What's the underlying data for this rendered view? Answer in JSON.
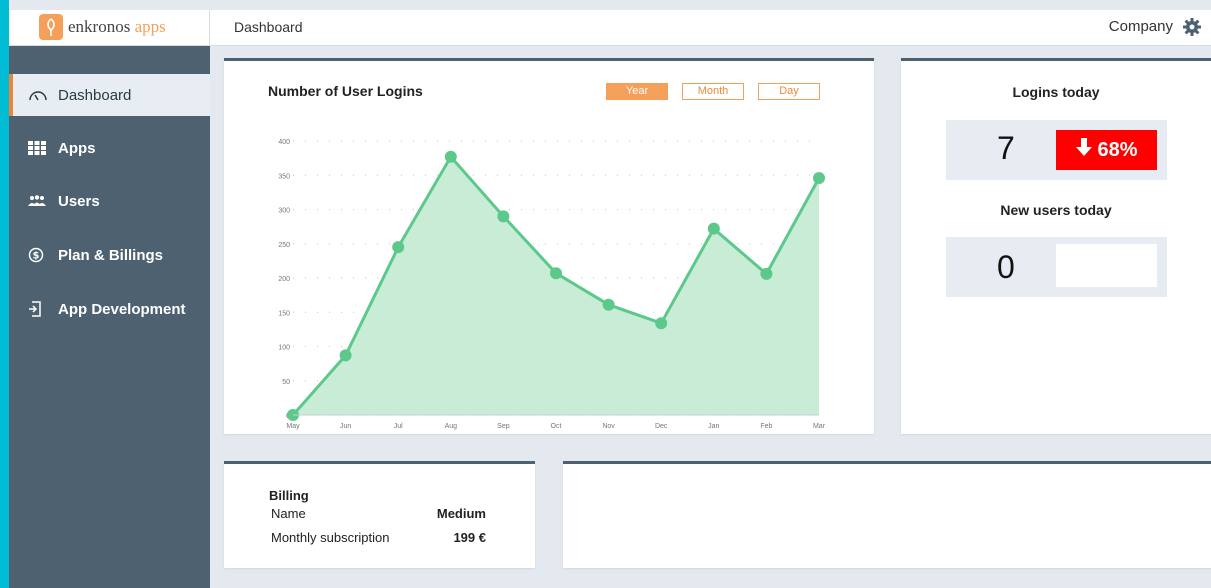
{
  "app": {
    "logo_name": "enkronos",
    "logo_suffix": "apps",
    "page_title": "Dashboard",
    "company_label": "Company"
  },
  "sidebar": {
    "items": [
      {
        "label": "Dashboard",
        "icon": "gauge-icon",
        "active": true
      },
      {
        "label": "Apps",
        "icon": "grid-icon",
        "active": false
      },
      {
        "label": "Users",
        "icon": "users-icon",
        "active": false
      },
      {
        "label": "Plan & Billings",
        "icon": "dollar-circle-icon",
        "active": false
      },
      {
        "label": "App Development",
        "icon": "exit-door-icon",
        "active": false
      }
    ]
  },
  "chart_panel": {
    "title": "Number of User Logins",
    "ranges": [
      {
        "label": "Year",
        "active": true
      },
      {
        "label": "Month",
        "active": false
      },
      {
        "label": "Day",
        "active": false
      }
    ]
  },
  "chart_data": {
    "type": "area",
    "title": "Number of User Logins",
    "categories": [
      "May",
      "Jun",
      "Jul",
      "Aug",
      "Sep",
      "Oct",
      "Nov",
      "Dec",
      "Jan",
      "Feb",
      "Mar"
    ],
    "values": [
      0,
      87,
      245,
      377,
      290,
      207,
      161,
      134,
      272,
      206,
      346
    ],
    "y_ticks": [
      0,
      50,
      100,
      150,
      200,
      250,
      300,
      350,
      400
    ],
    "ylim": [
      0,
      400
    ],
    "grid": "dotted",
    "colors": {
      "line": "#5cc98a",
      "fill": "#c8ecd6"
    }
  },
  "logins_panel": {
    "logins_heading": "Logins today",
    "logins_value": "7",
    "logins_change": "68%",
    "logins_change_direction": "down",
    "new_users_heading": "New users today",
    "new_users_value": "0"
  },
  "billing": {
    "title": "Billing",
    "name_label": "Name",
    "name_value": "Medium",
    "subscription_label": "Monthly subscription",
    "subscription_value": "199 €"
  },
  "colors": {
    "accent": "#f5a05a",
    "sidebar": "#4d6170",
    "alert": "#ff0000",
    "edge": "#00bcd4"
  }
}
